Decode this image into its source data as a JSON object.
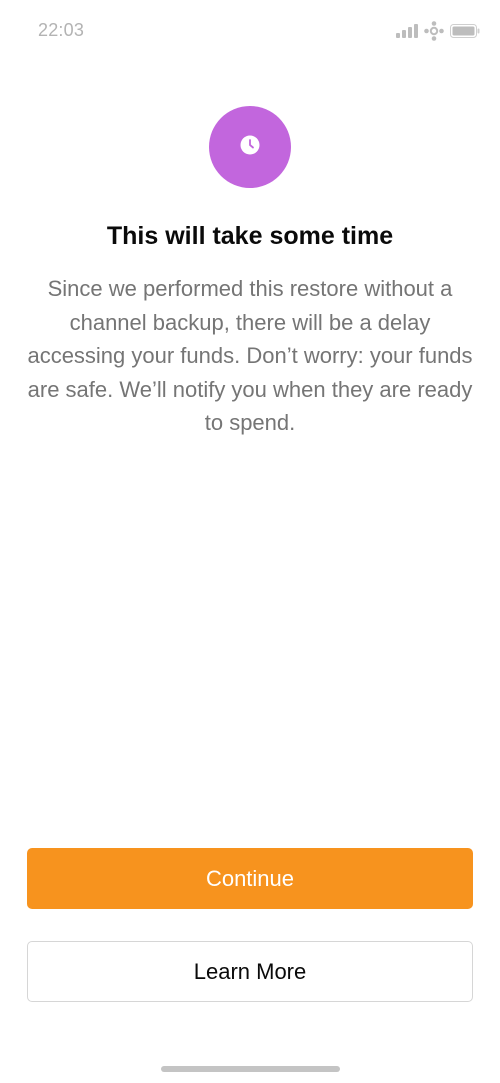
{
  "status_bar": {
    "time": "22:03",
    "icons": [
      "signal-icon",
      "network-icon",
      "battery-icon"
    ]
  },
  "colors": {
    "accent": "#c266dd",
    "primary": "#f7931e"
  },
  "icon": "clock-icon",
  "title": "This will take some time",
  "body": "Since we performed this restore without a channel backup, there will be a delay accessing your funds. Don’t worry: your funds are safe. We’ll notify you when they are ready to spend.",
  "buttons": {
    "continue_label": "Continue",
    "learn_more_label": "Learn More"
  }
}
